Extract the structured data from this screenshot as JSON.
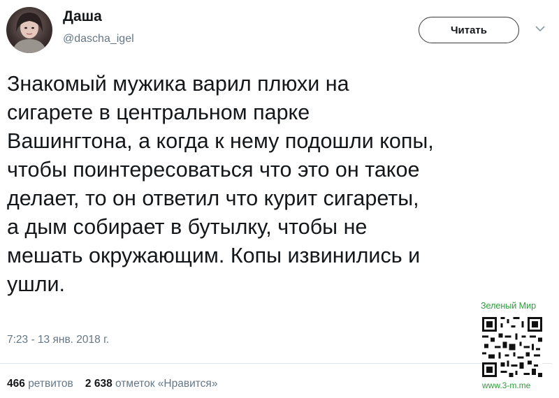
{
  "author": {
    "name": "Даша",
    "handle": "@dascha_igel"
  },
  "follow_button": {
    "label": "Читать"
  },
  "tweet": {
    "lines": [
      "Знакомый мужика варил плюхи на",
      "сигарете в центральном парке",
      "Вашингтона, а когда к нему подошли копы,",
      "чтобы поинтересоваться что это он такое",
      "делает, то он ответил что курит сигареты,",
      "а дым собирает в бутылку, чтобы не",
      "мешать окружающим. Копы извинились и",
      "ушли."
    ],
    "timestamp": "7:23 - 13 янв. 2018 г."
  },
  "stats": {
    "retweets_count": "466",
    "retweets_label": "ретвитов",
    "likes_count": "2 638",
    "likes_label": "отметок «Нравится»"
  },
  "watermark": {
    "title": "Зеленый Мир",
    "url": "www.3-m.me",
    "color": "#2e9c3b"
  },
  "icons": {
    "chevron": "chevron-down-icon",
    "avatar": "avatar",
    "qr": "qr-code-icon"
  }
}
